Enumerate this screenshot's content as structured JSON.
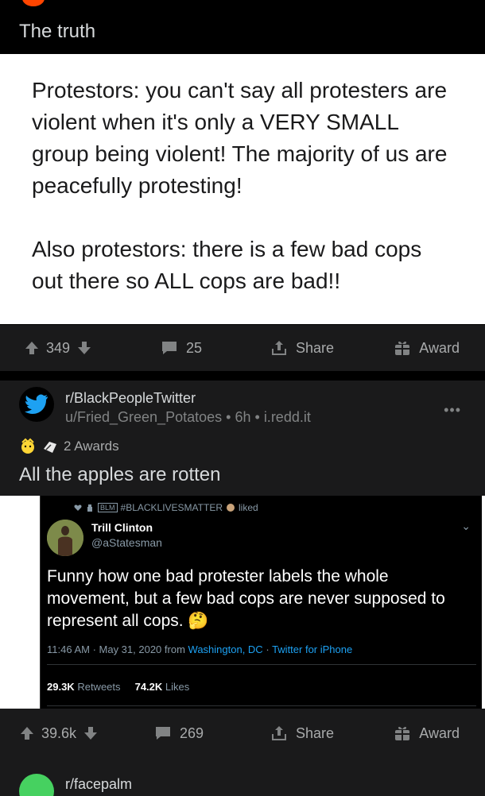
{
  "post1": {
    "title": "The truth",
    "paragraph1": "Protestors: you can't say all protesters are violent when it's only a VERY SMALL group being violent! The majority of us are peacefully protesting!",
    "paragraph2": "Also protestors: there is a few bad cops out there so ALL cops are bad!!",
    "actions": {
      "votes": "349",
      "comments": "25",
      "share": "Share",
      "award": "Award"
    }
  },
  "post2": {
    "subreddit": "r/BlackPeopleTwitter",
    "user": "u/Fried_Green_Potatoes",
    "time": "6h",
    "domain": "i.redd.it",
    "awards": "2 Awards",
    "title": "All the apples are rotten",
    "tweet": {
      "liked_by": "#BLACKLIVESMATTER",
      "liked_label": "liked",
      "name": "Trill Clinton",
      "handle": "@aStatesman",
      "text": "Funny how one bad protester labels the whole movement, but a few bad cops are never supposed to represent all cops. 🤔",
      "time": "11:46 AM · May 31, 2020 from",
      "location": "Washington, DC",
      "separator": "·",
      "source": "Twitter for iPhone",
      "retweets": "29.3K",
      "retweets_label": "Retweets",
      "likes": "74.2K",
      "likes_label": "Likes"
    },
    "actions": {
      "votes": "39.6k",
      "comments": "269",
      "share": "Share",
      "award": "Award"
    }
  },
  "post3": {
    "subreddit": "r/facepalm"
  },
  "colors": {
    "bg": "#000000",
    "card": "#1a1a1b",
    "text": "#d7dadc",
    "muted": "#818384",
    "twitter_blue": "#1da1f2"
  }
}
